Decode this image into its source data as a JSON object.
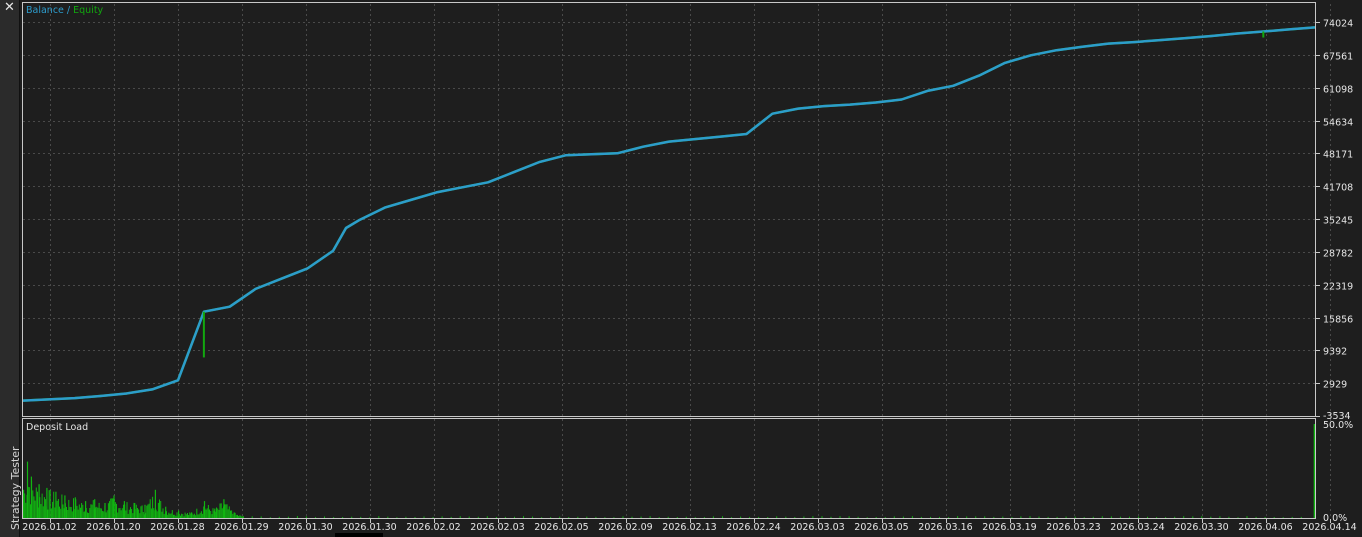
{
  "app": {
    "tab_label": "Strategy Tester",
    "close_label": "✕"
  },
  "colors": {
    "background": "#1e1e1e",
    "frame": "#c8c8c8",
    "grid": "#4a4a4a",
    "balance": "#2d9ccc",
    "equity": "#12a80f",
    "load": "#11b511",
    "text": "#e6e6e6"
  },
  "chart_data": [
    {
      "type": "line",
      "legend": {
        "placement": "top-left",
        "separator": " / "
      },
      "series": [
        {
          "name": "Balance",
          "color": "#2d9ccc"
        },
        {
          "name": "Equity",
          "color": "#12a80f"
        }
      ],
      "y_ticks": [
        "74024",
        "67561",
        "61098",
        "54634",
        "48171",
        "41708",
        "35245",
        "28782",
        "22319",
        "15856",
        "9392",
        "2929",
        "-3534"
      ],
      "ylim": [
        -3534,
        78000
      ],
      "grid": true,
      "x_index": [
        0,
        4,
        6,
        8,
        10,
        12,
        14,
        16,
        18,
        20,
        22,
        24,
        25,
        26,
        28,
        30,
        32,
        34,
        36,
        38,
        40,
        42,
        44,
        46,
        48,
        50,
        52,
        54,
        56,
        58,
        60,
        62,
        64,
        66,
        68,
        70,
        72,
        74,
        76,
        78,
        80,
        82,
        84,
        86,
        88,
        90,
        92,
        94,
        96,
        98,
        100
      ],
      "balance": [
        -500,
        0,
        400,
        900,
        1700,
        3500,
        17000,
        18000,
        21500,
        23500,
        25500,
        29000,
        33500,
        35000,
        37500,
        39000,
        40500,
        41500,
        42500,
        44500,
        46500,
        47800,
        48000,
        48200,
        49500,
        50500,
        51000,
        51500,
        52000,
        56000,
        57000,
        57500,
        57800,
        58200,
        58800,
        60500,
        61500,
        63500,
        66000,
        67500,
        68500,
        69200,
        69800,
        70100,
        70500,
        70900,
        71300,
        71800,
        72200,
        72600,
        73000
      ],
      "equity_dips": [
        {
          "x": 14,
          "y": 8000
        },
        {
          "x": 96,
          "y": 71000
        }
      ]
    },
    {
      "type": "bar",
      "title": "Deposit Load",
      "y_ticks": [
        "50.0%",
        "0.0%"
      ],
      "ylim": [
        0,
        50
      ],
      "grid": true,
      "peaks": [
        [
          0.0,
          15
        ],
        [
          0.3,
          30
        ],
        [
          0.6,
          22
        ],
        [
          1.2,
          18
        ],
        [
          1.8,
          16
        ],
        [
          2.5,
          14
        ],
        [
          3.2,
          12
        ],
        [
          4.0,
          11
        ],
        [
          4.8,
          9
        ],
        [
          5.5,
          10
        ],
        [
          6.3,
          8
        ],
        [
          7.0,
          12
        ],
        [
          7.8,
          9
        ],
        [
          8.6,
          8
        ],
        [
          9.4,
          7
        ],
        [
          10.2,
          15
        ],
        [
          11.0,
          6
        ],
        [
          12.0,
          4
        ],
        [
          13.0,
          3
        ],
        [
          14.0,
          9
        ],
        [
          14.8,
          5
        ],
        [
          15.5,
          10
        ],
        [
          16.3,
          3
        ],
        [
          17.0,
          1
        ]
      ],
      "end_spike": {
        "x": 99.9,
        "y": 50
      },
      "x_labels": [
        "2026.01.02",
        "2026.01.20",
        "2026.01.28",
        "2026.01.29",
        "2026.01.30",
        "2026.01.30",
        "2026.02.02",
        "2026.02.03",
        "2026.02.05",
        "2026.02.09",
        "2026.02.13",
        "2026.02.24",
        "2026.03.03",
        "2026.03.05",
        "2026.03.16",
        "2026.03.19",
        "2026.03.23",
        "2026.03.24",
        "2026.03.30",
        "2026.04.06",
        "2026.04.14"
      ]
    }
  ]
}
